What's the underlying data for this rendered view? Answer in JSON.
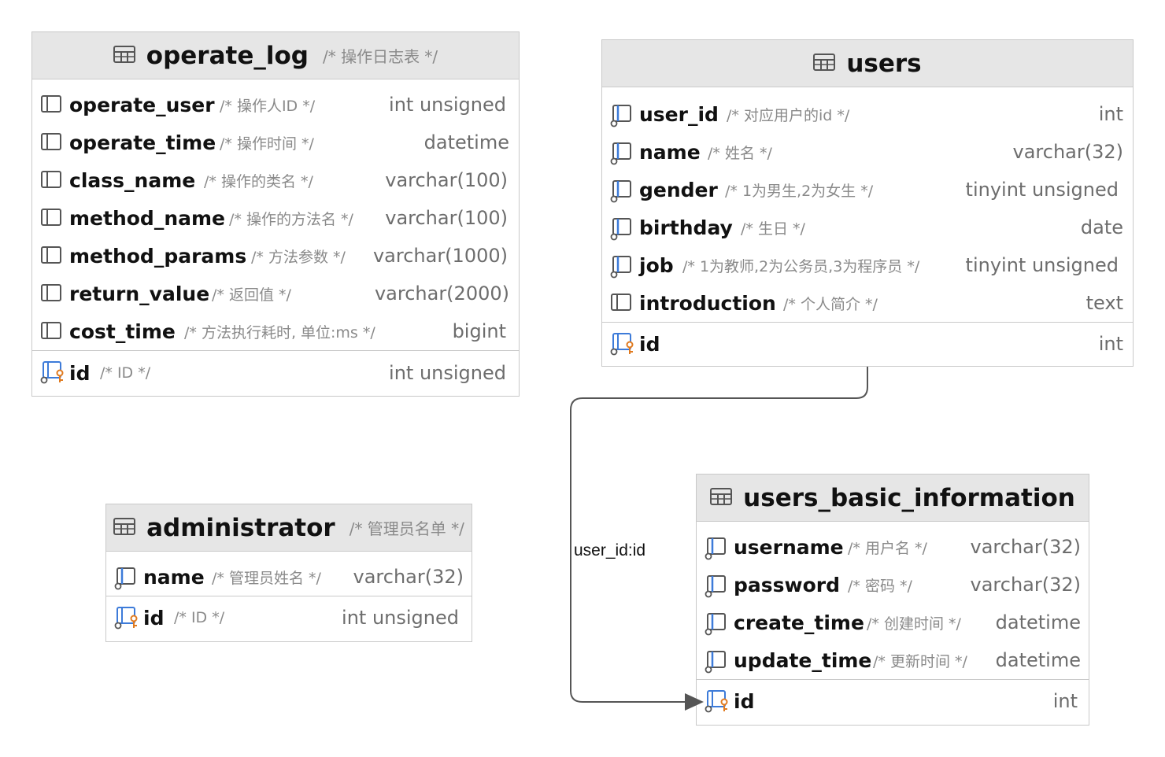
{
  "tables": {
    "operate_log": {
      "name": "operate_log",
      "comment": "/* 操作日志表 */",
      "columns": [
        {
          "name": "operate_user",
          "comment": "/* 操作人ID */",
          "type": "int unsigned",
          "icon": "column-icon"
        },
        {
          "name": "operate_time",
          "comment": "/* 操作时间 */",
          "type": "datetime",
          "icon": "column-icon"
        },
        {
          "name": "class_name",
          "comment": "/* 操作的类名 */",
          "type": "varchar(100)",
          "icon": "column-icon"
        },
        {
          "name": "method_name",
          "comment": "/* 操作的方法名 */",
          "type": "varchar(100)",
          "icon": "column-icon"
        },
        {
          "name": "method_params",
          "comment": "/* 方法参数 */",
          "type": "varchar(1000)",
          "icon": "column-icon"
        },
        {
          "name": "return_value",
          "comment": "/* 返回值 */",
          "type": "varchar(2000)",
          "icon": "column-icon"
        },
        {
          "name": "cost_time",
          "comment": "/* 方法执行耗时, 单位:ms */",
          "type": "bigint",
          "icon": "column-icon"
        }
      ],
      "pk": {
        "name": "id",
        "comment": "/* ID */",
        "type": "int unsigned",
        "icon": "primary-key-icon"
      }
    },
    "users": {
      "name": "users",
      "comment": "",
      "columns": [
        {
          "name": "user_id",
          "comment": "/* 对应用户的id */",
          "type": "int",
          "icon": "not-null-column-icon"
        },
        {
          "name": "name",
          "comment": "/* 姓名 */",
          "type": "varchar(32)",
          "icon": "not-null-column-icon"
        },
        {
          "name": "gender",
          "comment": "/* 1为男生,2为女生 */",
          "type": "tinyint unsigned",
          "icon": "not-null-column-icon"
        },
        {
          "name": "birthday",
          "comment": "/* 生日 */",
          "type": "date",
          "icon": "not-null-column-icon"
        },
        {
          "name": "job",
          "comment": "/* 1为教师,2为公务员,3为程序员 */",
          "type": "tinyint unsigned",
          "icon": "not-null-column-icon"
        },
        {
          "name": "introduction",
          "comment": "/* 个人简介 */",
          "type": "text",
          "icon": "column-icon"
        }
      ],
      "pk": {
        "name": "id",
        "comment": "",
        "type": "int",
        "icon": "primary-key-icon"
      }
    },
    "administrator": {
      "name": "administrator",
      "comment": "/* 管理员名单 */",
      "columns": [
        {
          "name": "name",
          "comment": "/* 管理员姓名 */",
          "type": "varchar(32)",
          "icon": "not-null-column-icon"
        }
      ],
      "pk": {
        "name": "id",
        "comment": "/* ID */",
        "type": "int unsigned",
        "icon": "primary-key-icon"
      }
    },
    "users_basic_information": {
      "name": "users_basic_information",
      "comment": "",
      "columns": [
        {
          "name": "username",
          "comment": "/* 用户名 */",
          "type": "varchar(32)",
          "icon": "not-null-column-icon"
        },
        {
          "name": "password",
          "comment": "/* 密码 */",
          "type": "varchar(32)",
          "icon": "not-null-column-icon"
        },
        {
          "name": "create_time",
          "comment": "/* 创建时间 */",
          "type": "datetime",
          "icon": "not-null-column-icon"
        },
        {
          "name": "update_time",
          "comment": "/* 更新时间 */",
          "type": "datetime",
          "icon": "not-null-column-icon"
        }
      ],
      "pk": {
        "name": "id",
        "comment": "",
        "type": "int",
        "icon": "primary-key-icon"
      }
    }
  },
  "relation": {
    "label": "user_id:id",
    "from": "users",
    "to": "users_basic_information"
  },
  "colors": {
    "header_bg": "#e6e6e6",
    "border": "#c9c9c9",
    "key_accent": "#e07a1f",
    "nn_accent": "#3d7bd9",
    "connector": "#555555"
  }
}
